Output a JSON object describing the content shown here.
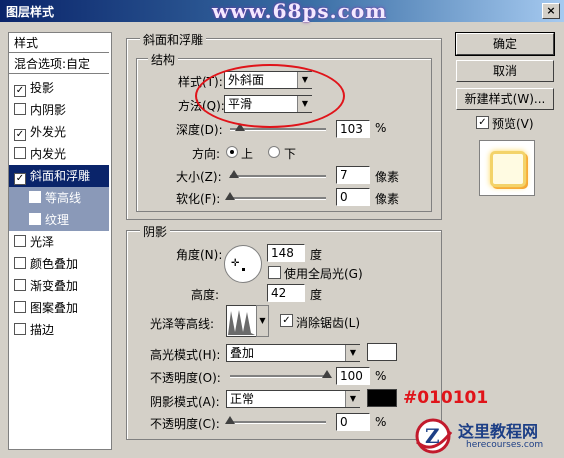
{
  "window": {
    "title": "图层样式",
    "watermark": "www.68ps.com",
    "close": "×"
  },
  "left_panel": {
    "header": "样式",
    "blend": "混合选项:自定",
    "items": [
      {
        "label": "投影",
        "checked": true
      },
      {
        "label": "内阴影",
        "checked": false
      },
      {
        "label": "外发光",
        "checked": true
      },
      {
        "label": "内发光",
        "checked": false
      },
      {
        "label": "斜面和浮雕",
        "checked": true,
        "selected": true
      },
      {
        "label": "等高线",
        "checked": false,
        "sub": true
      },
      {
        "label": "纹理",
        "checked": false,
        "sub": true
      },
      {
        "label": "光泽",
        "checked": false
      },
      {
        "label": "颜色叠加",
        "checked": false
      },
      {
        "label": "渐变叠加",
        "checked": false
      },
      {
        "label": "图案叠加",
        "checked": false
      },
      {
        "label": "描边",
        "checked": false
      }
    ]
  },
  "bevel": {
    "group_title": "斜面和浮雕",
    "structure_title": "结构",
    "style_label": "样式(T):",
    "style_value": "外斜面",
    "technique_label": "方法(Q):",
    "technique_value": "平滑",
    "depth_label": "深度(D):",
    "depth_value": "103",
    "depth_unit": "%",
    "depth_fraction": 0.1,
    "direction_label": "方向:",
    "direction_up": "上",
    "direction_down": "下",
    "size_label": "大小(Z):",
    "size_value": "7",
    "size_unit": "像素",
    "soften_label": "软化(F):",
    "soften_value": "0",
    "soften_unit": "像素"
  },
  "shading": {
    "title": "阴影",
    "angle_label": "角度(N):",
    "angle_value": "148",
    "angle_unit": "度",
    "global_light": "使用全局光(G)",
    "altitude_label": "高度:",
    "altitude_value": "42",
    "altitude_unit": "度",
    "gloss_label": "光泽等高线:",
    "anti_alias": "消除锯齿(L)",
    "highlight_mode_label": "高光模式(H):",
    "highlight_mode": "叠加",
    "highlight_color": "#ffffff",
    "opacity1_label": "不透明度(O):",
    "opacity1_value": "100",
    "opacity_unit": "%",
    "shadow_mode_label": "阴影模式(A):",
    "shadow_mode": "正常",
    "shadow_color": "#010101",
    "opacity2_label": "不透明度(C):",
    "opacity2_value": "0"
  },
  "buttons": {
    "ok": "确定",
    "cancel": "取消",
    "new_style": "新建样式(W)...",
    "preview": "预览(V)"
  },
  "annotation": {
    "text": "#010101"
  },
  "logo": {
    "main": "这里教程网",
    "site": "herecourses.com",
    "letter": "Z"
  }
}
